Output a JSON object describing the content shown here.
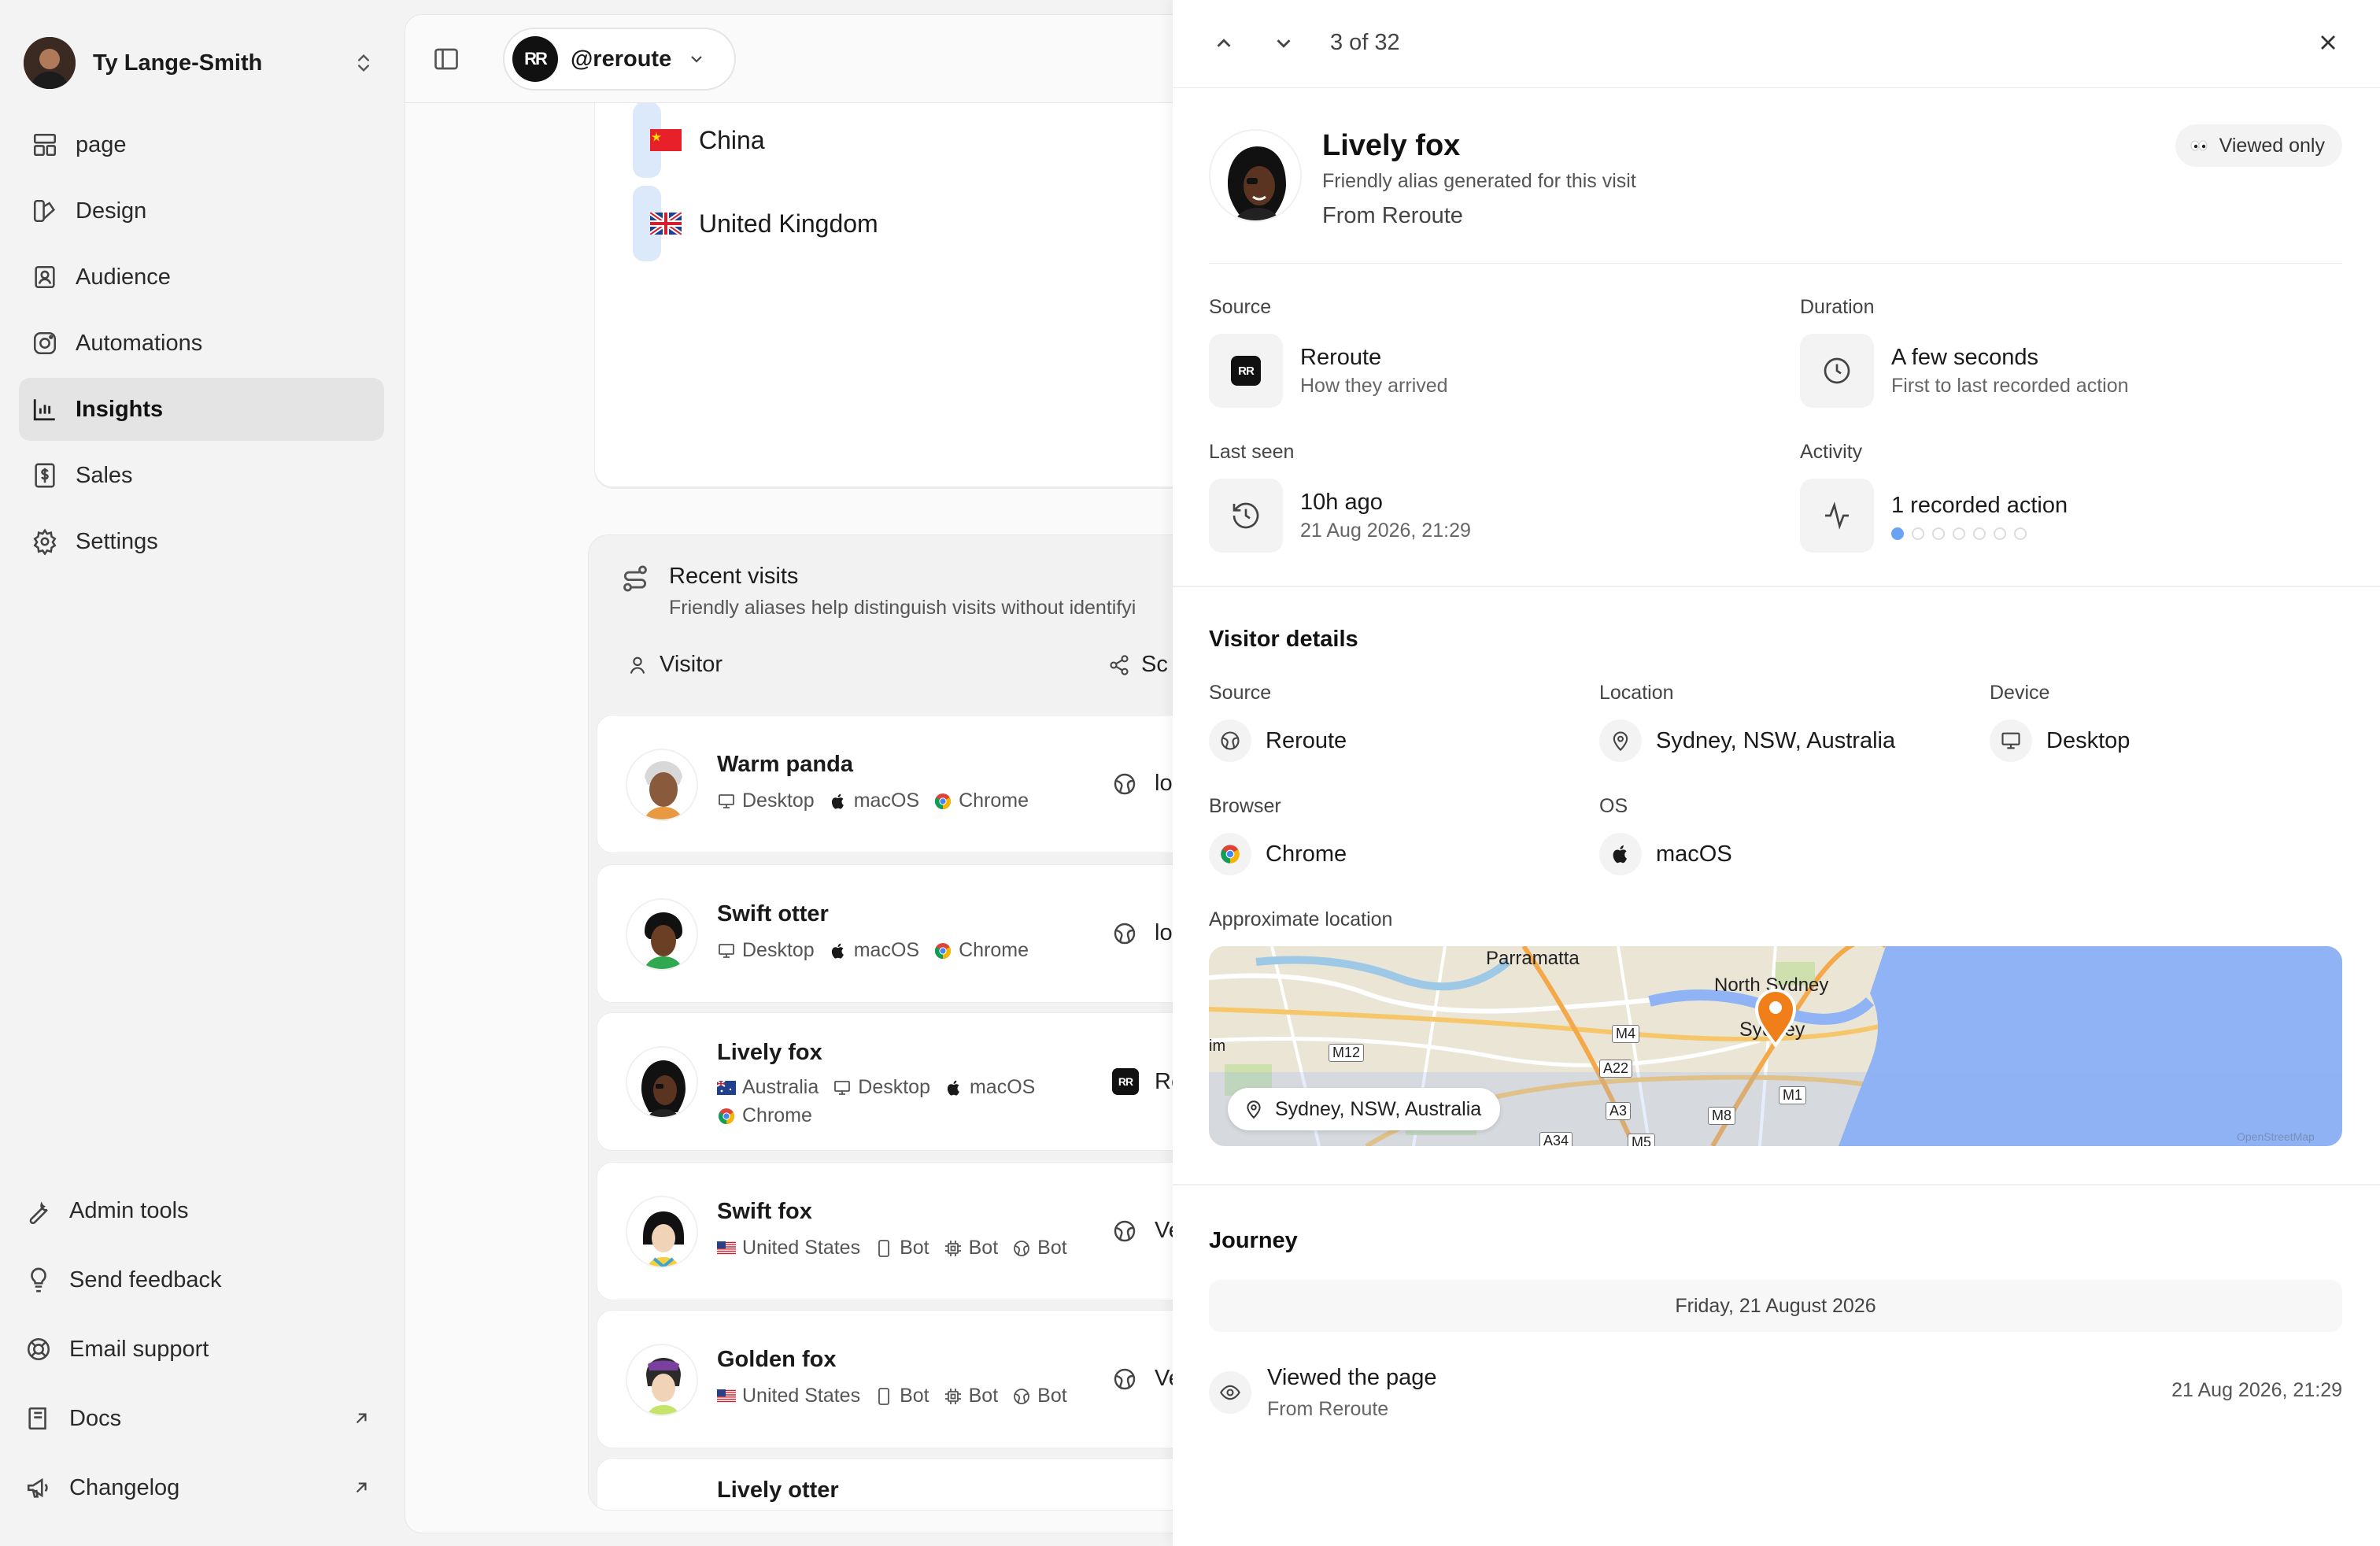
{
  "user": {
    "name": "Ty Lange-Smith"
  },
  "nav": [
    {
      "label": "page",
      "icon": "layout-icon"
    },
    {
      "label": "Design",
      "icon": "palette-icon"
    },
    {
      "label": "Audience",
      "icon": "contact-icon"
    },
    {
      "label": "Automations",
      "icon": "instagram-icon"
    },
    {
      "label": "Insights",
      "icon": "bar-chart-icon",
      "active": true
    },
    {
      "label": "Sales",
      "icon": "dollar-file-icon"
    },
    {
      "label": "Settings",
      "icon": "gear-icon"
    }
  ],
  "bottom_nav": [
    {
      "label": "Admin tools",
      "icon": "wrench-icon"
    },
    {
      "label": "Send feedback",
      "icon": "lightbulb-icon"
    },
    {
      "label": "Email support",
      "icon": "lifebuoy-icon"
    },
    {
      "label": "Docs",
      "icon": "book-icon",
      "external": true
    },
    {
      "label": "Changelog",
      "icon": "megaphone-icon",
      "external": true
    }
  ],
  "workspace": {
    "handle": "@reroute",
    "logo_text": "RR"
  },
  "countries": [
    {
      "name": "China",
      "flag": "cn"
    },
    {
      "name": "United Kingdom",
      "flag": "gb"
    }
  ],
  "recent_visits": {
    "title": "Recent visits",
    "subtitle": "Friendly aliases help distinguish visits without identifyi",
    "col_visitor": "Visitor",
    "col_source": "Sc",
    "rows": [
      {
        "name": "Warm panda",
        "meta": [
          "Desktop",
          "macOS",
          "Chrome"
        ],
        "meta2": [],
        "source": "lo"
      },
      {
        "name": "Swift otter",
        "meta": [
          "Desktop",
          "macOS",
          "Chrome"
        ],
        "meta2": [],
        "source": "lo"
      },
      {
        "name": "Lively fox",
        "meta": [
          "Australia",
          "Desktop",
          "macOS"
        ],
        "meta2": [
          "Chrome"
        ],
        "source": "Re"
      },
      {
        "name": "Swift fox",
        "meta": [
          "United States",
          "Bot",
          "Bot",
          "Bot"
        ],
        "meta2": [],
        "source": "Ve"
      },
      {
        "name": "Golden fox",
        "meta": [
          "United States",
          "Bot",
          "Bot",
          "Bot"
        ],
        "meta2": [],
        "source": "Ve"
      },
      {
        "name": "Lively otter",
        "meta": [],
        "meta2": [],
        "source": ""
      }
    ]
  },
  "detail": {
    "position": "3 of 32",
    "name": "Lively fox",
    "alias_note": "Friendly alias generated for this visit",
    "from": "From Reroute",
    "viewed_badge": "Viewed only",
    "stats": {
      "source_label": "Source",
      "source_value": "Reroute",
      "source_sub": "How they arrived",
      "duration_label": "Duration",
      "duration_value": "A few seconds",
      "duration_sub": "First to last recorded action",
      "last_seen_label": "Last seen",
      "last_seen_value": "10h ago",
      "last_seen_sub": "21 Aug 2026, 21:29",
      "activity_label": "Activity",
      "activity_value": "1 recorded action",
      "activity_fraction": 0.14
    },
    "visitor_details": {
      "title": "Visitor details",
      "source_label": "Source",
      "source": "Reroute",
      "location_label": "Location",
      "location": "Sydney, NSW, Australia",
      "device_label": "Device",
      "device": "Desktop",
      "browser_label": "Browser",
      "browser": "Chrome",
      "os_label": "OS",
      "os": "macOS"
    },
    "map": {
      "title": "Approximate location",
      "pill": "Sydney, NSW, Australia",
      "labels": {
        "parramatta": "Parramatta",
        "north_sydney": "North Sydney",
        "sydney": "Sydney",
        "m4": "M4",
        "m12": "M12",
        "a22": "A22",
        "a3": "A3",
        "m8": "M8",
        "m1": "M1",
        "a34": "A34",
        "m5": "M5",
        "edge": "im",
        "attribution": "OpenStreetMap"
      }
    },
    "journey": {
      "title": "Journey",
      "date": "Friday, 21 August 2026",
      "event_title": "Viewed the page",
      "event_sub": "From Reroute",
      "event_time": "21 Aug 2026, 21:29"
    }
  },
  "colors": {
    "accent_blue": "#6aa3f2",
    "map_pin": "#f07f1a",
    "water": "#8fb3f4"
  }
}
